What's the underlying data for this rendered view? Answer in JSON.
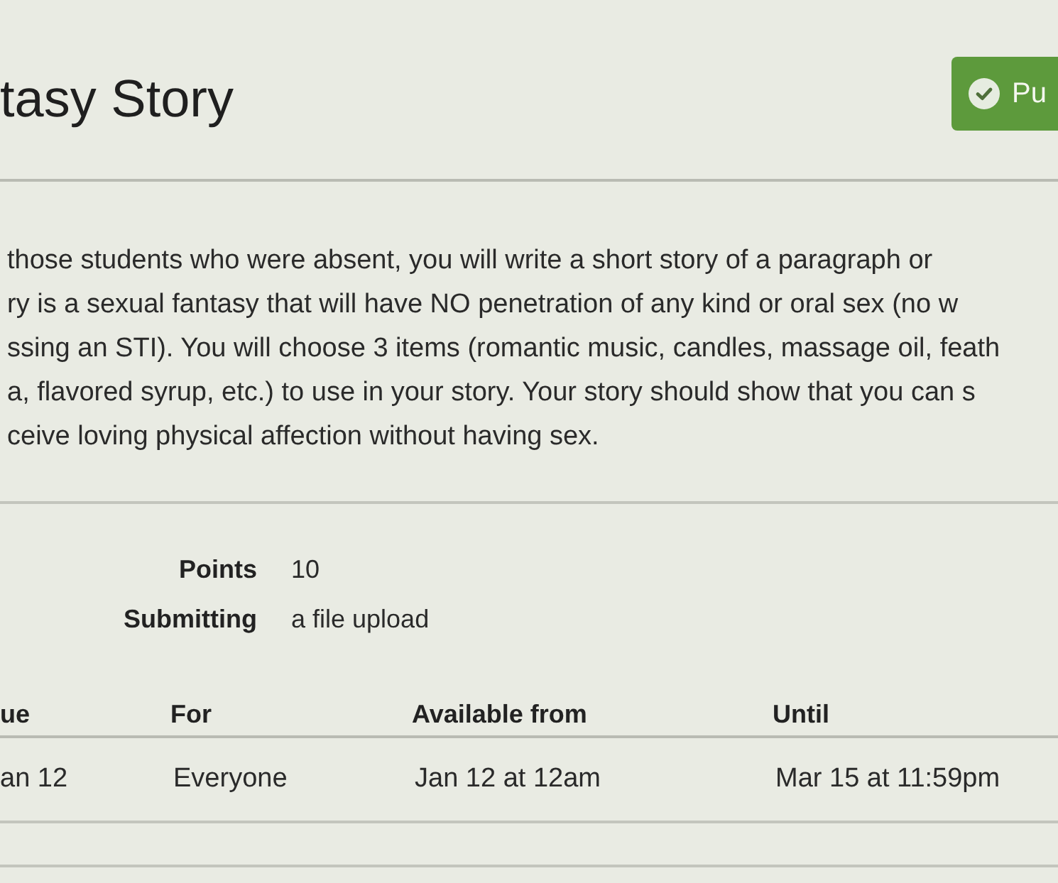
{
  "header": {
    "title": "tasy Story",
    "button": {
      "label": "Pu"
    }
  },
  "description": {
    "lines": [
      "those students who were absent, you will write a short story of a paragraph or",
      "ry is a sexual fantasy that will have NO penetration of any kind or oral sex (no w",
      "ssing an STI). You will choose 3 items (romantic music, candles, massage oil, feath",
      "a, flavored syrup, etc.) to use in your story. Your story should show that you can s",
      "ceive loving physical affection without having sex."
    ]
  },
  "details": [
    {
      "label": "Points",
      "value": "10"
    },
    {
      "label": "Submitting",
      "value": "a file upload"
    }
  ],
  "dates_table": {
    "columns": [
      "ue",
      "For",
      "Available from",
      "Until"
    ],
    "rows": [
      [
        "an 12",
        "Everyone",
        "Jan 12 at 12am",
        "Mar 15 at 11:59pm"
      ]
    ]
  }
}
